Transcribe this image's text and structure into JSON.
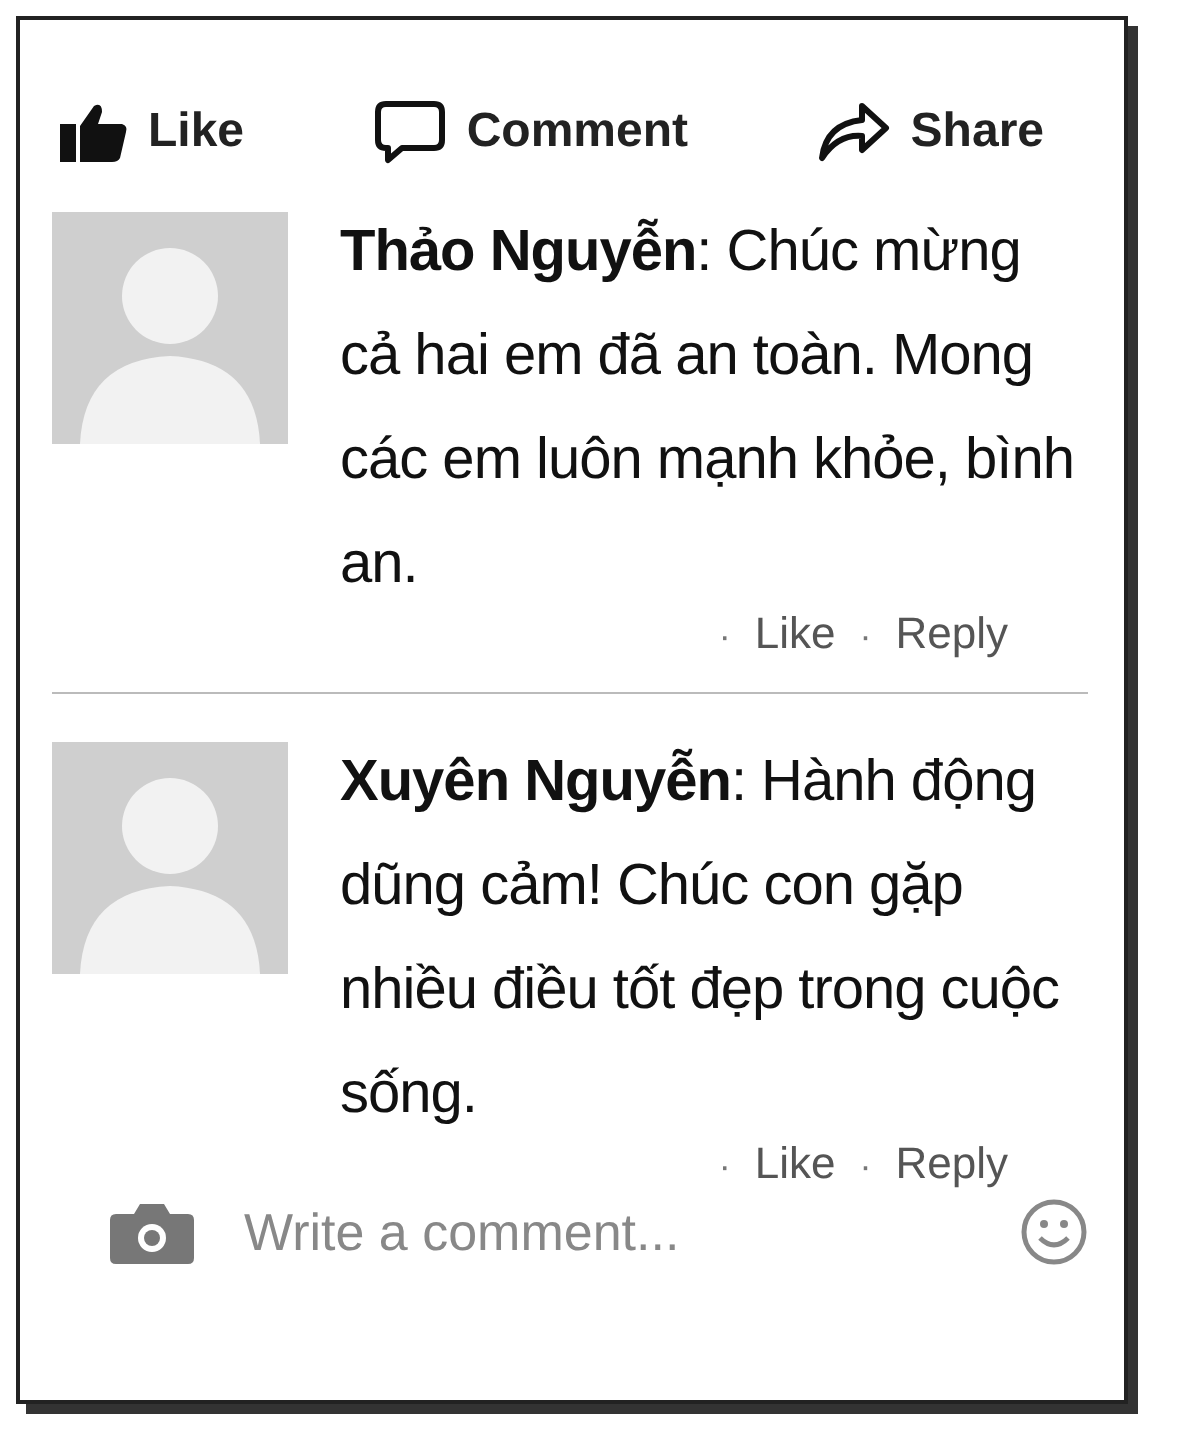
{
  "actions": [
    {
      "kind": "like",
      "label": "Like"
    },
    {
      "kind": "comment",
      "label": "Comment"
    },
    {
      "kind": "share",
      "label": "Share"
    }
  ],
  "comments": [
    {
      "text": "**Thảo Nguyễn**: Chúc mừng cả hai em đã an toàn. Mong các em luôn mạnh khỏe, bình an.",
      "links": [
        {
          "separator": "·",
          "label": "Like"
        },
        {
          "separator": "·",
          "label": "Reply"
        }
      ]
    },
    {
      "text": "**Xuyên Nguyễn**: Hành động dũng cảm! Chúc con gặp nhiều điều tốt đẹp trong cuộc sống.",
      "links": [
        {
          "separator": "·",
          "label": "Like"
        },
        {
          "separator": "·",
          "label": "Reply"
        }
      ]
    }
  ],
  "composer": {
    "placeholder": "Write a comment..."
  }
}
